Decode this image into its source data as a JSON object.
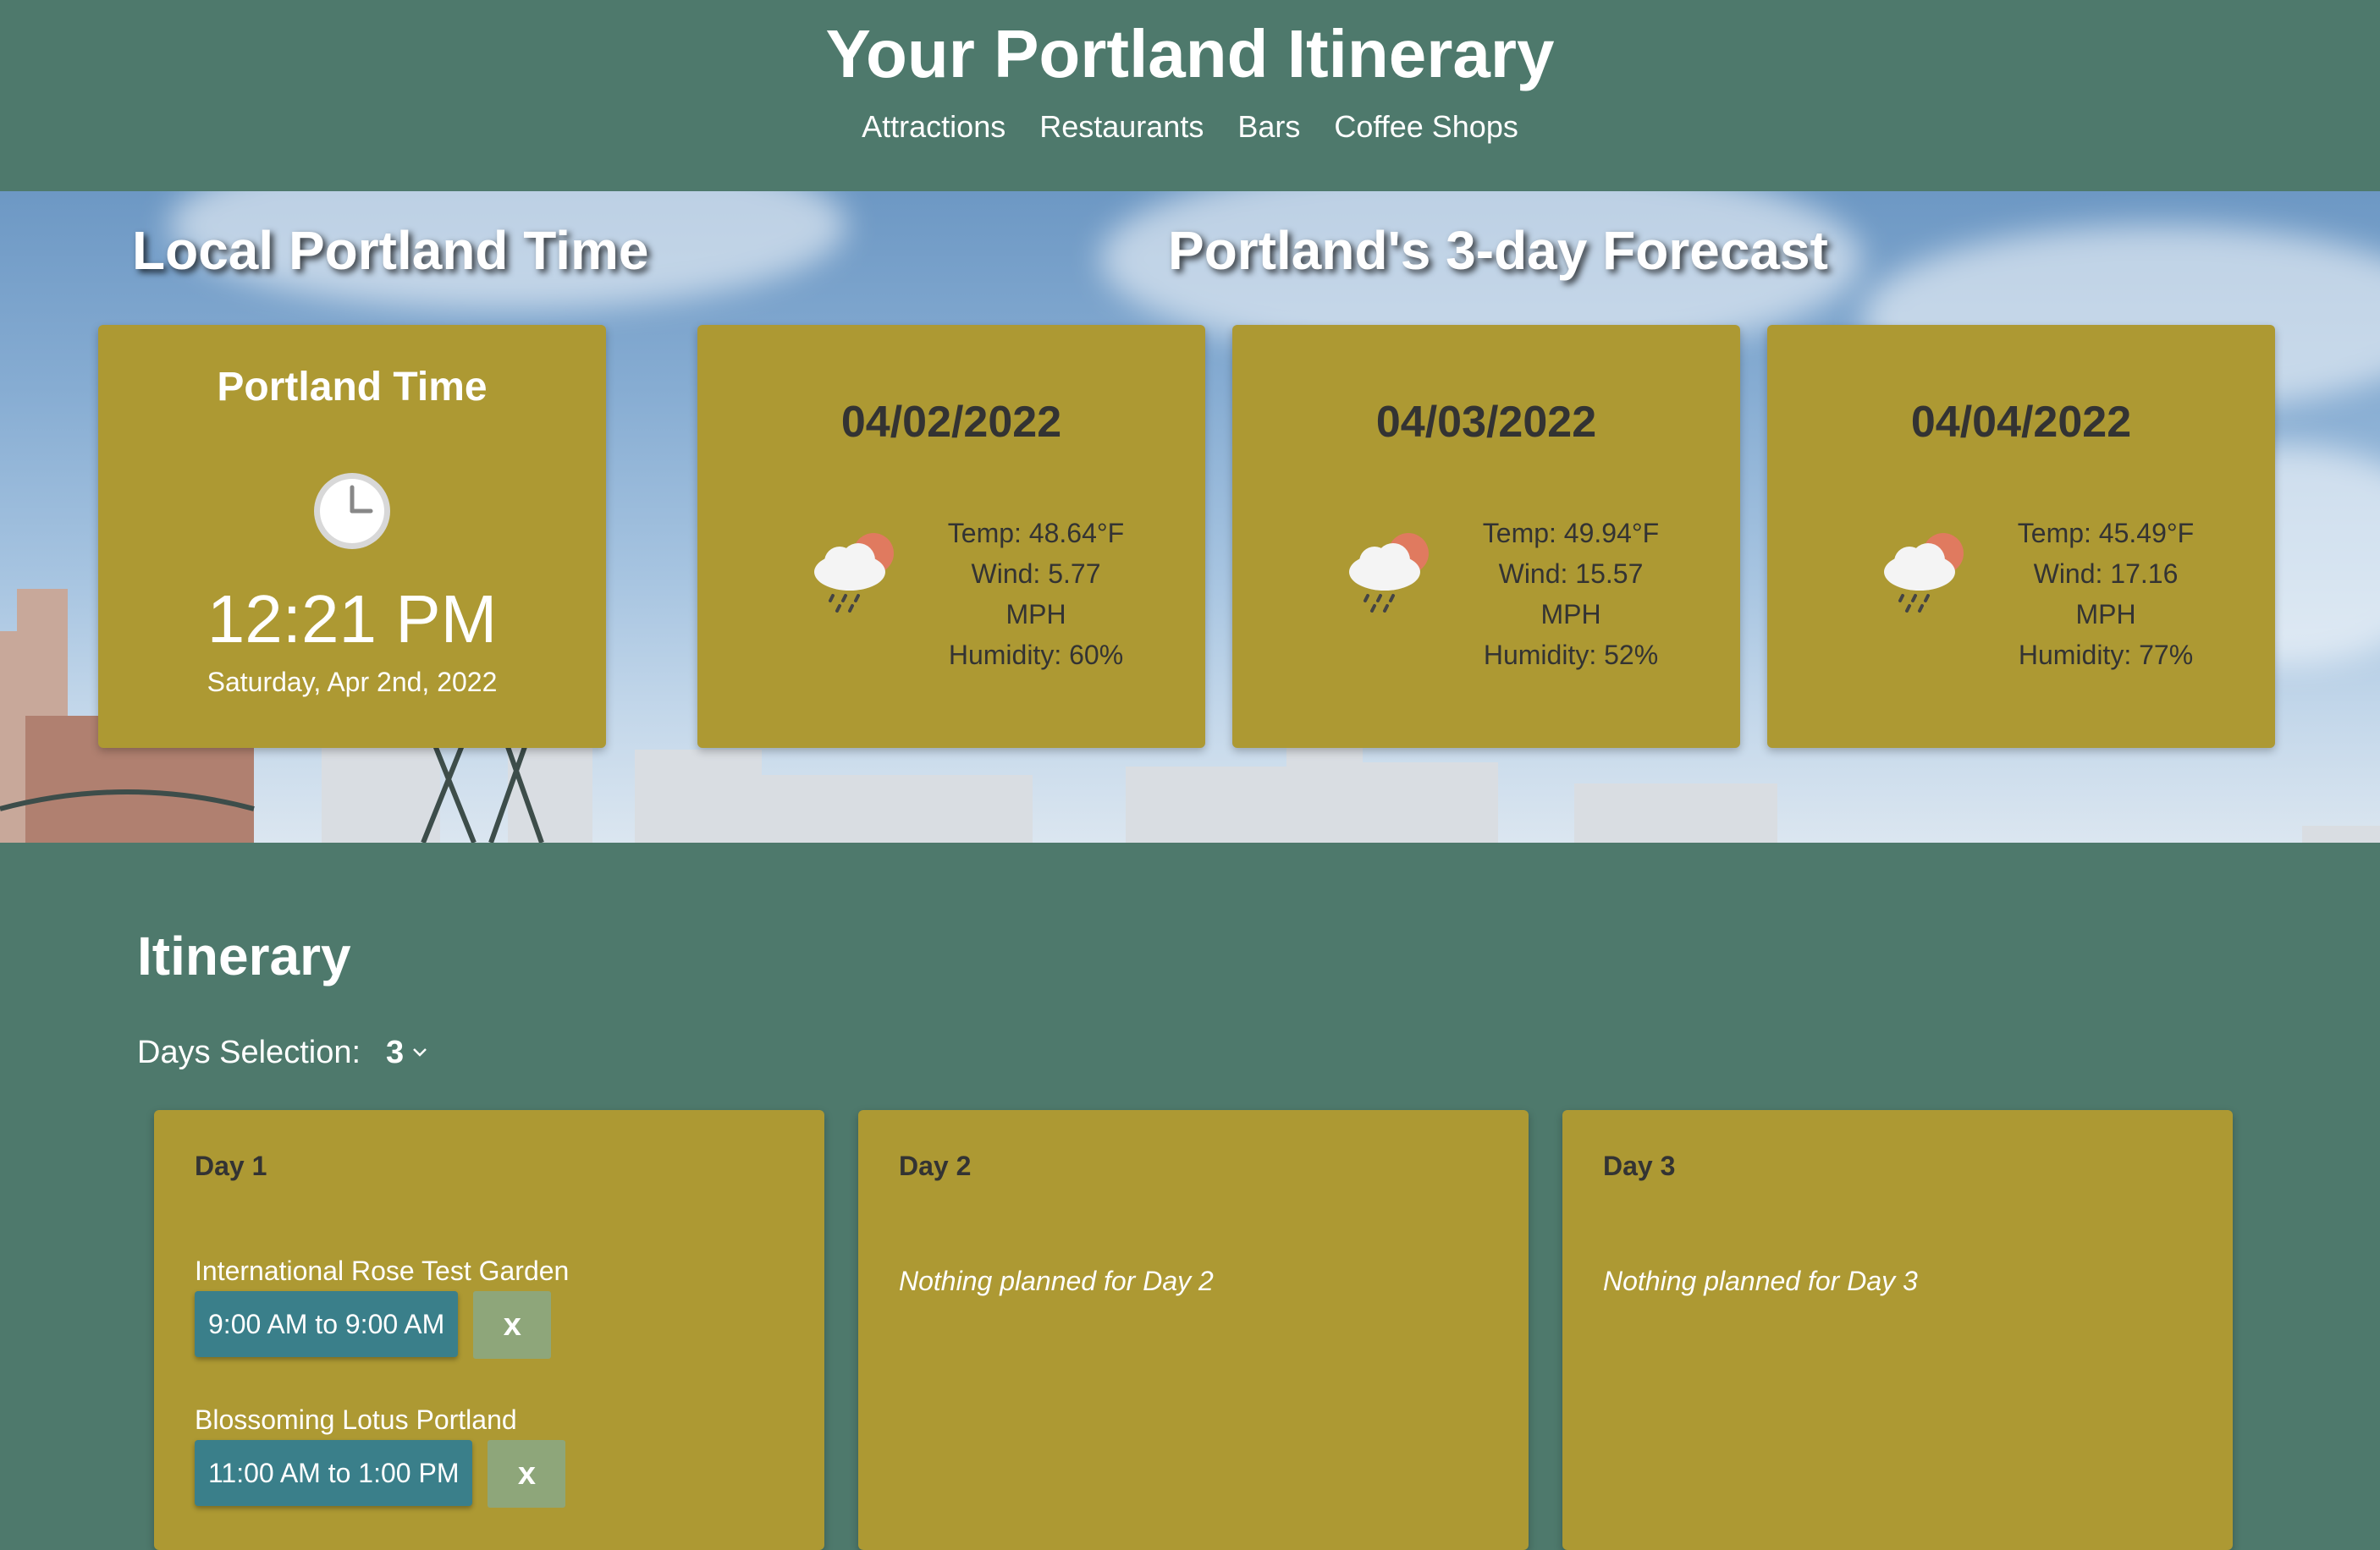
{
  "header": {
    "title": "Your Portland Itinerary",
    "nav": [
      "Attractions",
      "Restaurants",
      "Bars",
      "Coffee Shops"
    ]
  },
  "time_section": {
    "heading": "Local Portland Time",
    "card_title": "Portland Time",
    "icon": "clock-icon",
    "time": "12:21 PM",
    "date": "Saturday, Apr 2nd, 2022"
  },
  "forecast": {
    "heading": "Portland's 3-day Forecast",
    "days": [
      {
        "date": "04/02/2022",
        "icon": "rain-cloud-sun-icon",
        "temp": "Temp: 48.64°F",
        "wind": "Wind: 5.77",
        "wind_unit": "MPH",
        "humidity": "Humidity: 60%"
      },
      {
        "date": "04/03/2022",
        "icon": "rain-cloud-sun-icon",
        "temp": "Temp: 49.94°F",
        "wind": "Wind: 15.57",
        "wind_unit": "MPH",
        "humidity": "Humidity: 52%"
      },
      {
        "date": "04/04/2022",
        "icon": "rain-cloud-sun-icon",
        "temp": "Temp: 45.49°F",
        "wind": "Wind: 17.16",
        "wind_unit": "MPH",
        "humidity": "Humidity: 77%"
      }
    ]
  },
  "itinerary": {
    "title": "Itinerary",
    "days_label": "Days Selection:",
    "days_value": "3",
    "days": [
      {
        "title": "Day 1",
        "events": [
          {
            "name": "International Rose Test Garden",
            "time": "9:00 AM to 9:00 AM",
            "remove": "x"
          },
          {
            "name": "Blossoming Lotus Portland",
            "time": "11:00 AM to 1:00 PM",
            "remove": "x"
          }
        ]
      },
      {
        "title": "Day 2",
        "empty": "Nothing planned for Day 2"
      },
      {
        "title": "Day 3",
        "empty": "Nothing planned for Day 3"
      }
    ]
  },
  "colors": {
    "background": "#4e796c",
    "card": "#ad9933",
    "time_button": "#3a7f8a",
    "remove_button": "#8ea67a",
    "weather_sun": "#e07a5f"
  }
}
